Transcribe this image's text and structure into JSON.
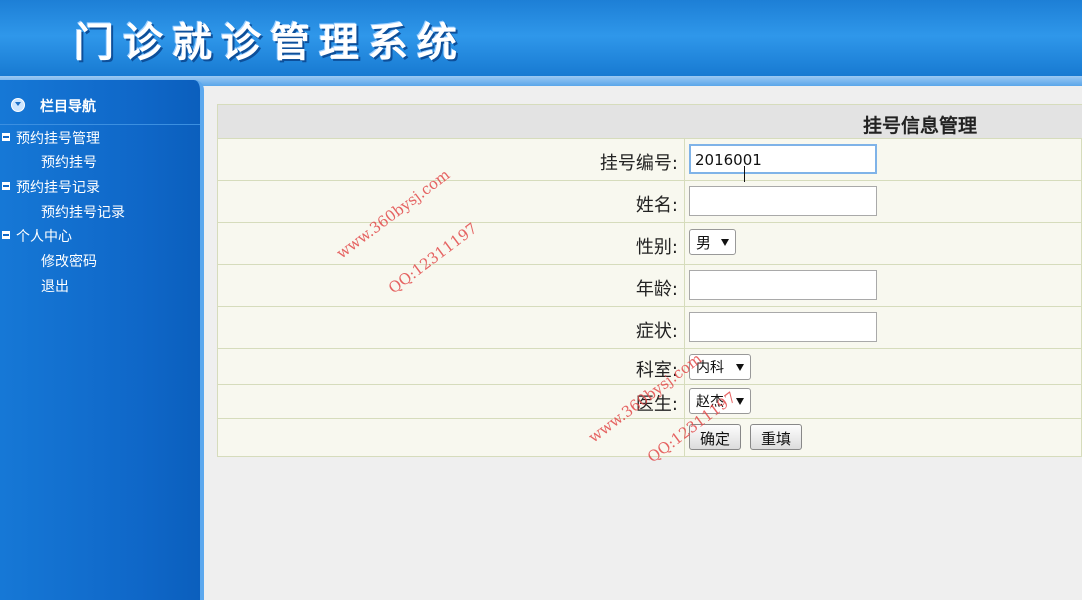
{
  "header": {
    "title": "门诊就诊管理系统"
  },
  "sidebar": {
    "heading": "栏目导航",
    "items": [
      {
        "label": "预约挂号管理",
        "type": "group"
      },
      {
        "label": "预约挂号",
        "type": "sub"
      },
      {
        "label": "预约挂号记录",
        "type": "group"
      },
      {
        "label": "预约挂号记录",
        "type": "sub"
      },
      {
        "label": "个人中心",
        "type": "group"
      },
      {
        "label": "修改密码",
        "type": "sub"
      },
      {
        "label": "退出",
        "type": "sub"
      }
    ]
  },
  "form": {
    "title": "挂号信息管理",
    "fields": {
      "reg_no": {
        "label": "挂号编号:",
        "value": "2016001"
      },
      "name": {
        "label": "姓名:",
        "value": ""
      },
      "gender": {
        "label": "性别:",
        "value": "男"
      },
      "age": {
        "label": "年龄:",
        "value": ""
      },
      "symptom": {
        "label": "症状:",
        "value": ""
      },
      "department": {
        "label": "科室:",
        "value": "内科"
      },
      "doctor": {
        "label": "医生:",
        "value": "赵杰"
      }
    },
    "buttons": {
      "submit": "确定",
      "reset": "重填"
    }
  },
  "watermark": {
    "site": "www.360bysj.com",
    "qq": "QQ:12311197"
  }
}
